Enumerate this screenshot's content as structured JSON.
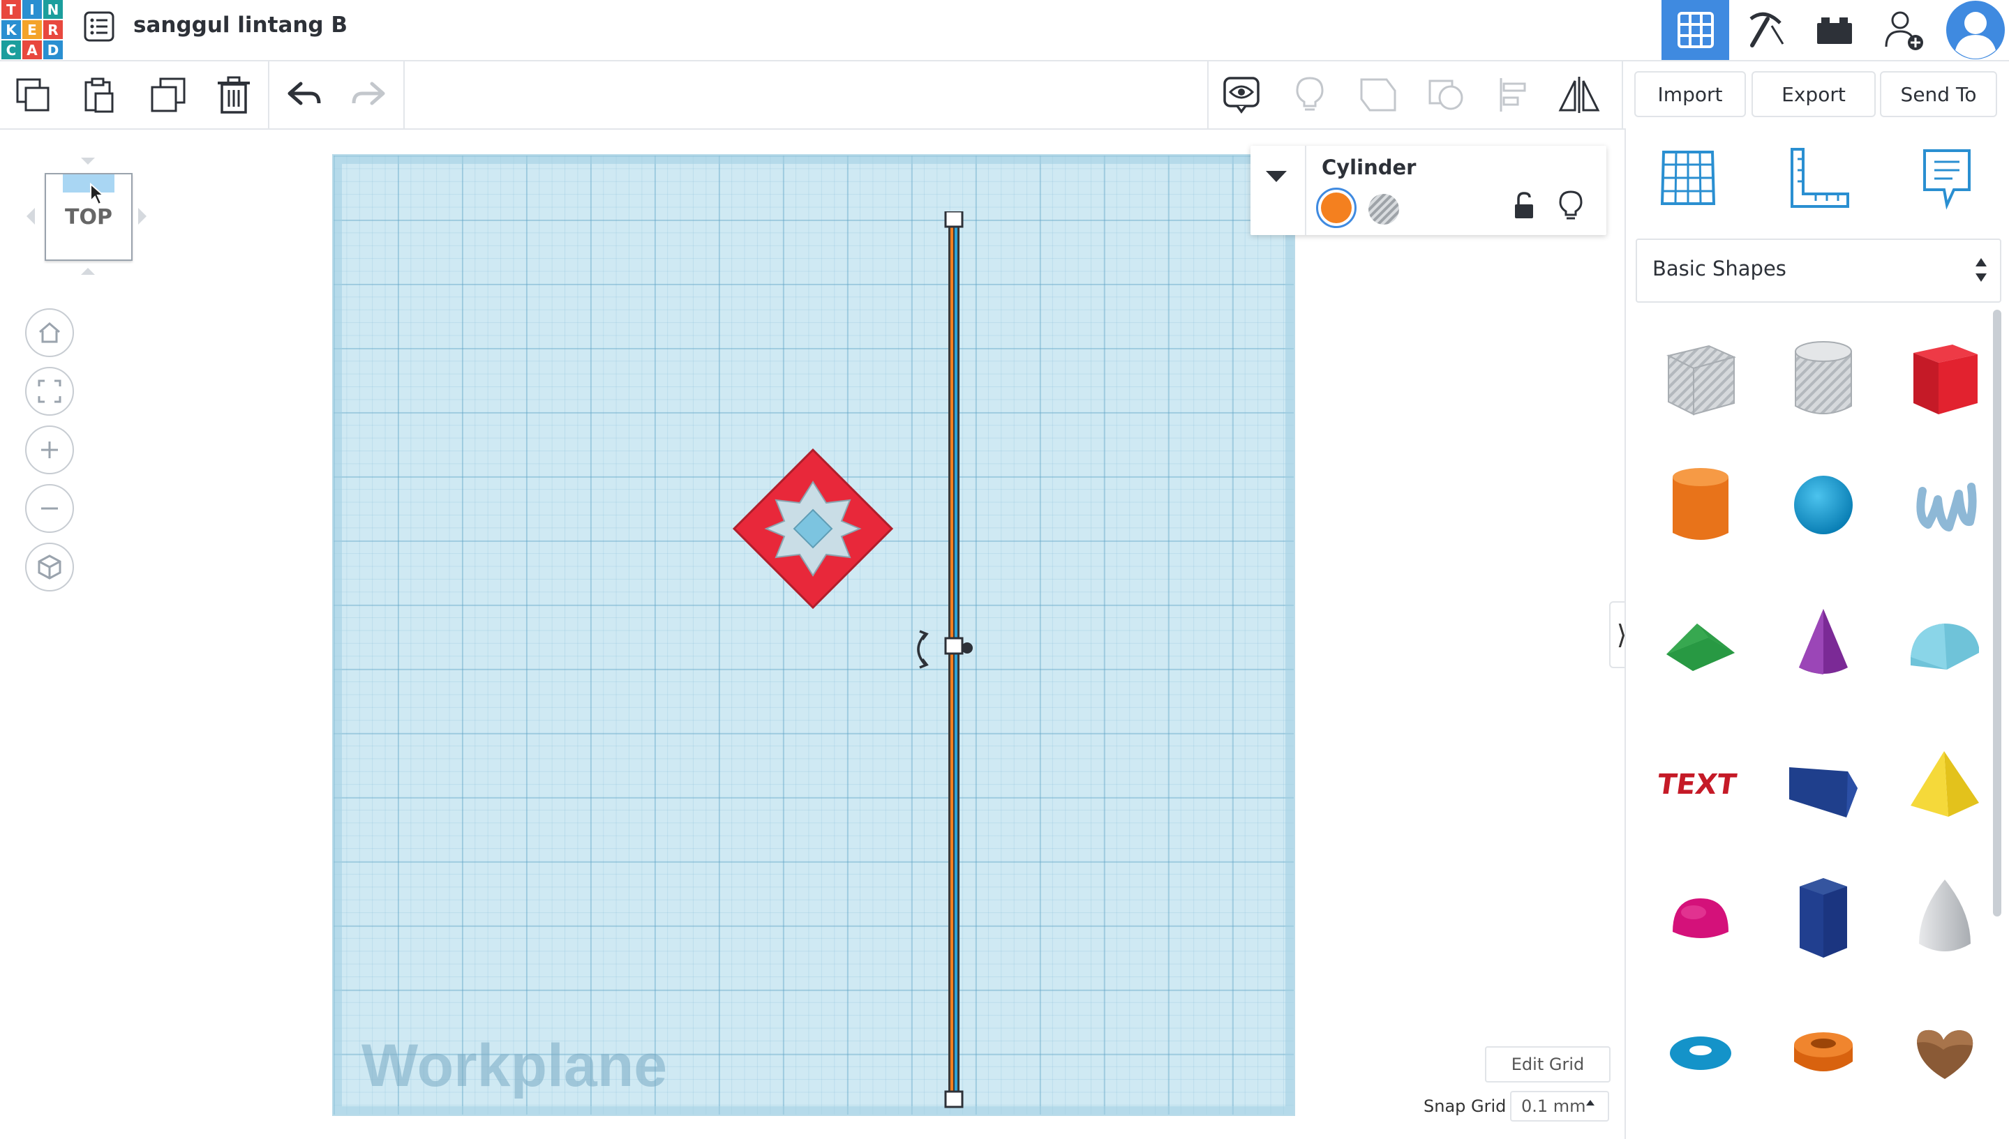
{
  "app": {
    "logo_letters": [
      "T",
      "I",
      "N",
      "K",
      "E",
      "R",
      "C",
      "A",
      "D"
    ],
    "logo_colors": [
      "#e8483e",
      "#2a8fd1",
      "#1b9e9d",
      "#2a8fd1",
      "#f4a32a",
      "#e8483e",
      "#1b9e9d",
      "#e8483e",
      "#2a8fd1"
    ],
    "design_title": "sanggul lintang B"
  },
  "header_nav": [
    {
      "name": "3d-design-view",
      "icon": "grid-view-icon",
      "active": true
    },
    {
      "name": "codeblocks-view",
      "icon": "pickaxe-icon",
      "active": false
    },
    {
      "name": "lego-bricks-view",
      "icon": "brick-icon",
      "active": false
    },
    {
      "name": "invite-user",
      "icon": "add-user-icon",
      "active": false
    },
    {
      "name": "profile",
      "icon": "avatar-icon",
      "active": false
    }
  ],
  "toolbar": {
    "copy_icon": "copy-icon",
    "paste_icon": "paste-icon",
    "duplicate_icon": "duplicate-icon",
    "delete_icon": "trash-icon",
    "undo_icon": "undo-icon",
    "redo_icon": "redo-icon",
    "import_label": "Import",
    "export_label": "Export",
    "send_to_label": "Send To"
  },
  "view_controls": {
    "viewcube_label": "TOP",
    "buttons": [
      "home-view",
      "fit-all",
      "zoom-in",
      "zoom-out",
      "perspective"
    ]
  },
  "workplane": {
    "label": "Workplane"
  },
  "inspector": {
    "shape_name": "Cylinder",
    "solid_color": "#f4801f"
  },
  "right_panel": {
    "tabs": [
      "workplane-tool",
      "ruler-tool",
      "notes-tool"
    ],
    "library_selected": "Basic Shapes",
    "shapes": [
      "Box Hole",
      "Cylinder Hole",
      "Box",
      "Cylinder",
      "Sphere",
      "Scribble",
      "Roof",
      "Cone",
      "Round Roof",
      "Text",
      "Wedge",
      "Pyramid",
      "Half Sphere",
      "Polygon",
      "Paraboloid",
      "Torus",
      "Tube",
      "Heart"
    ]
  },
  "grid_controls": {
    "edit_grid_label": "Edit Grid",
    "snap_grid_label": "Snap Grid",
    "snap_grid_value": "0.1 mm"
  }
}
